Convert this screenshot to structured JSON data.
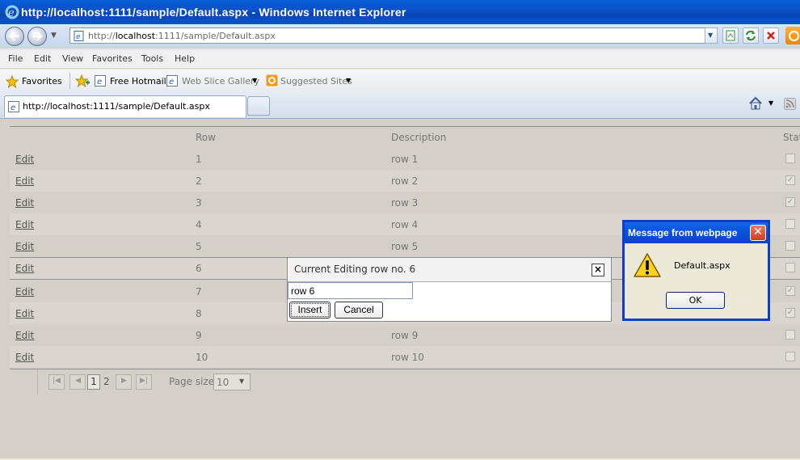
{
  "window": {
    "title": "http://localhost:1111/sample/Default.aspx - Windows Internet Explorer"
  },
  "address": {
    "prefix": "http://",
    "host": "localhost",
    "rest": ":1111/sample/Default.aspx"
  },
  "menu": [
    "File",
    "Edit",
    "View",
    "Favorites",
    "Tools",
    "Help"
  ],
  "favorites_bar": {
    "favorites": "Favorites",
    "free_hotmail": "Free Hotmail",
    "web_slice": "Web Slice Gallery",
    "suggested": "Suggested Sites"
  },
  "tab": {
    "title": "http://localhost:1111/sample/Default.aspx"
  },
  "grid": {
    "headers": {
      "row": "Row",
      "description": "Description",
      "status": "Stat"
    },
    "rows": [
      {
        "edit": "Edit",
        "row": "1",
        "description": "row 1",
        "checked": false
      },
      {
        "edit": "Edit",
        "row": "2",
        "description": "row 2",
        "checked": true
      },
      {
        "edit": "Edit",
        "row": "3",
        "description": "row 3",
        "checked": true
      },
      {
        "edit": "Edit",
        "row": "4",
        "description": "row 4",
        "checked": false
      },
      {
        "edit": "Edit",
        "row": "5",
        "description": "row 5",
        "checked": false
      },
      {
        "edit": "Edit",
        "row": "6",
        "description": "",
        "checked": false
      },
      {
        "edit": "Edit",
        "row": "7",
        "description": "",
        "checked": true
      },
      {
        "edit": "Edit",
        "row": "8",
        "description": "",
        "checked": true
      },
      {
        "edit": "Edit",
        "row": "9",
        "description": "row 9",
        "checked": false
      },
      {
        "edit": "Edit",
        "row": "10",
        "description": "row 10",
        "checked": false
      }
    ]
  },
  "pager": {
    "pages": [
      "1",
      "2"
    ],
    "current": "1",
    "page_size_label": "Page size:",
    "page_size": "10"
  },
  "edit_dialog": {
    "title": "Current Editing row no. 6",
    "input_value": "row 6",
    "insert": "Insert",
    "cancel": "Cancel",
    "close": "×"
  },
  "message_box": {
    "title": "Message from webpage",
    "text": "Default.aspx",
    "ok": "OK",
    "close": "✕"
  }
}
